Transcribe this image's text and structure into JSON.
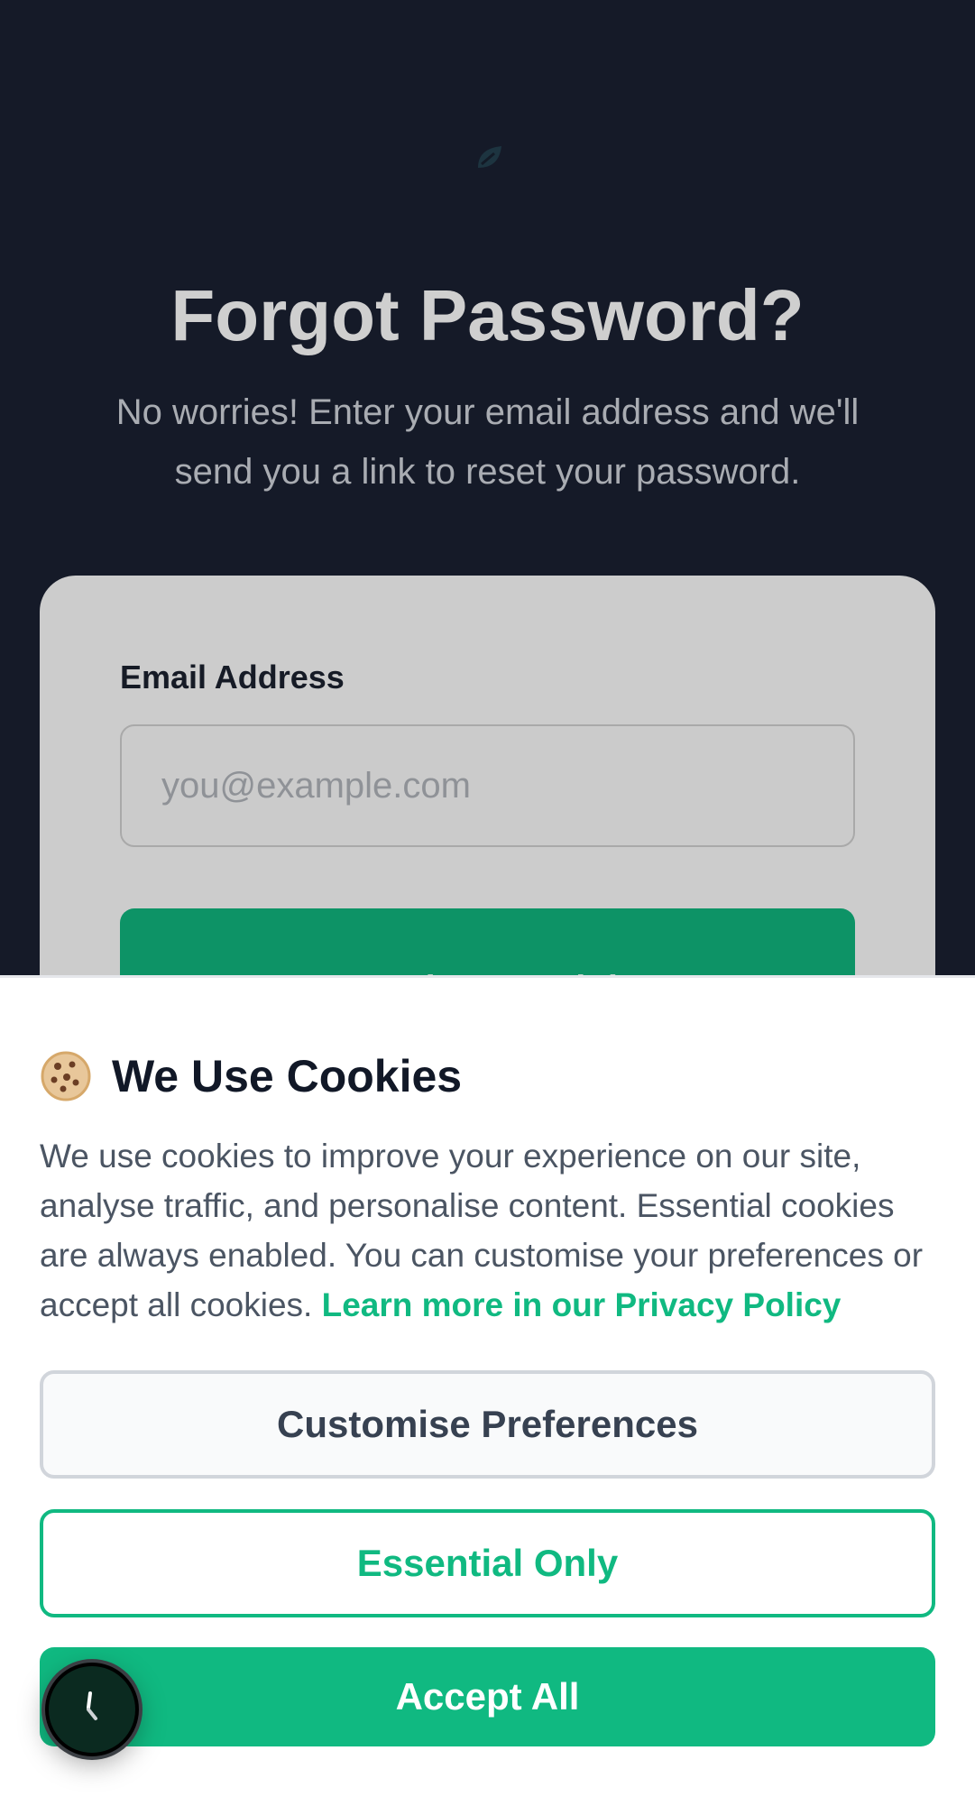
{
  "page": {
    "title": "Forgot Password?",
    "subtitle": "No worries! Enter your email address and we'll send you a link to reset your password."
  },
  "form": {
    "email_label": "Email Address",
    "email_placeholder": "you@example.com",
    "email_value": "",
    "submit_label": "Send Reset Link"
  },
  "cookie_banner": {
    "icon": "cookie-icon",
    "title": "We Use Cookies",
    "body": "We use cookies to improve your experience on our site, analyse traffic, and personalise content. Essential cookies are always enabled. You can customise your preferences or accept all cookies.",
    "privacy_link": "Learn more in our Privacy Policy",
    "buttons": {
      "customise": "Customise Preferences",
      "essential": "Essential Only",
      "accept": "Accept All"
    }
  },
  "floating_button": {
    "icon": "loading-spinner-icon"
  },
  "colors": {
    "background": "#151a28",
    "accent": "#10b981",
    "card": "#cccccc"
  }
}
